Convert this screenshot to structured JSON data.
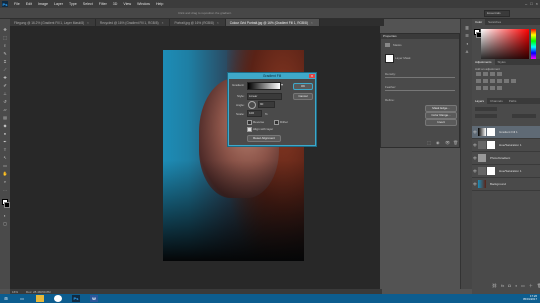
{
  "menu": [
    "File",
    "Edit",
    "Image",
    "Layer",
    "Type",
    "Select",
    "Filter",
    "3D",
    "View",
    "Window",
    "Help"
  ],
  "app_icon": "Ps",
  "options_bar": {
    "hint": "Click and drag to reposition the gradient.",
    "workspace": "Essentials"
  },
  "tabs": [
    {
      "label": "Fliegung @ 16.2% (Gradient Fill 1, Layer Mask/8)"
    },
    {
      "label": "Recycled @ 16% (Gradient Fill 1, RGB/8)"
    },
    {
      "label": "Portrait.jpg @ 16% (RGB/8)"
    },
    {
      "label": "Colour Grid Portrait.jpg @ 16% (Gradient Fill 1, RGB/8)"
    }
  ],
  "dialog": {
    "title": "Gradient Fill",
    "gradient_label": "Gradient:",
    "style_label": "Style:",
    "style_value": "Linear",
    "angle_label": "Angle:",
    "angle_value": "90",
    "scale_label": "Scale:",
    "scale_value": "100",
    "scale_unit": "%",
    "reverse_label": "Reverse",
    "dither_label": "Dither",
    "align_label": "Align with layer",
    "reset_button": "Reset Alignment",
    "ok_button": "OK",
    "cancel_button": "Cancel",
    "reverse": false,
    "dither": false,
    "align": true
  },
  "properties_panel": {
    "title": "Properties",
    "section": "Masks",
    "layer_mask": "Layer Mask",
    "density_label": "Density:",
    "feather_label": "Feather:",
    "refine_label": "Refine:",
    "mask_edge_button": "Mask Edge...",
    "color_range_button": "Color Range...",
    "invert_button": "Invert"
  },
  "color_panel": {
    "tabs": [
      "Color",
      "Swatches"
    ],
    "fg": "#ffffff",
    "bg": "#000000"
  },
  "adjustments_panel": {
    "tabs": [
      "Adjustments",
      "Styles"
    ],
    "hint": "Add an adjustment"
  },
  "layers_panel": {
    "tabs": [
      "Layers",
      "Channels",
      "Paths"
    ],
    "layers": [
      {
        "name": "Gradient Fill 1",
        "selected": true
      },
      {
        "name": "Hue/Saturation 1",
        "selected": false
      },
      {
        "name": "Photo/Gradient",
        "selected": false
      },
      {
        "name": "Hue/Saturation 1",
        "selected": false
      },
      {
        "name": "Background",
        "selected": false
      }
    ]
  },
  "status_bar": {
    "zoom": "16%",
    "doc": "Doc: 28.4M/60.8M"
  },
  "taskbar": {
    "time": "17:26",
    "date": "05/01/2017"
  }
}
